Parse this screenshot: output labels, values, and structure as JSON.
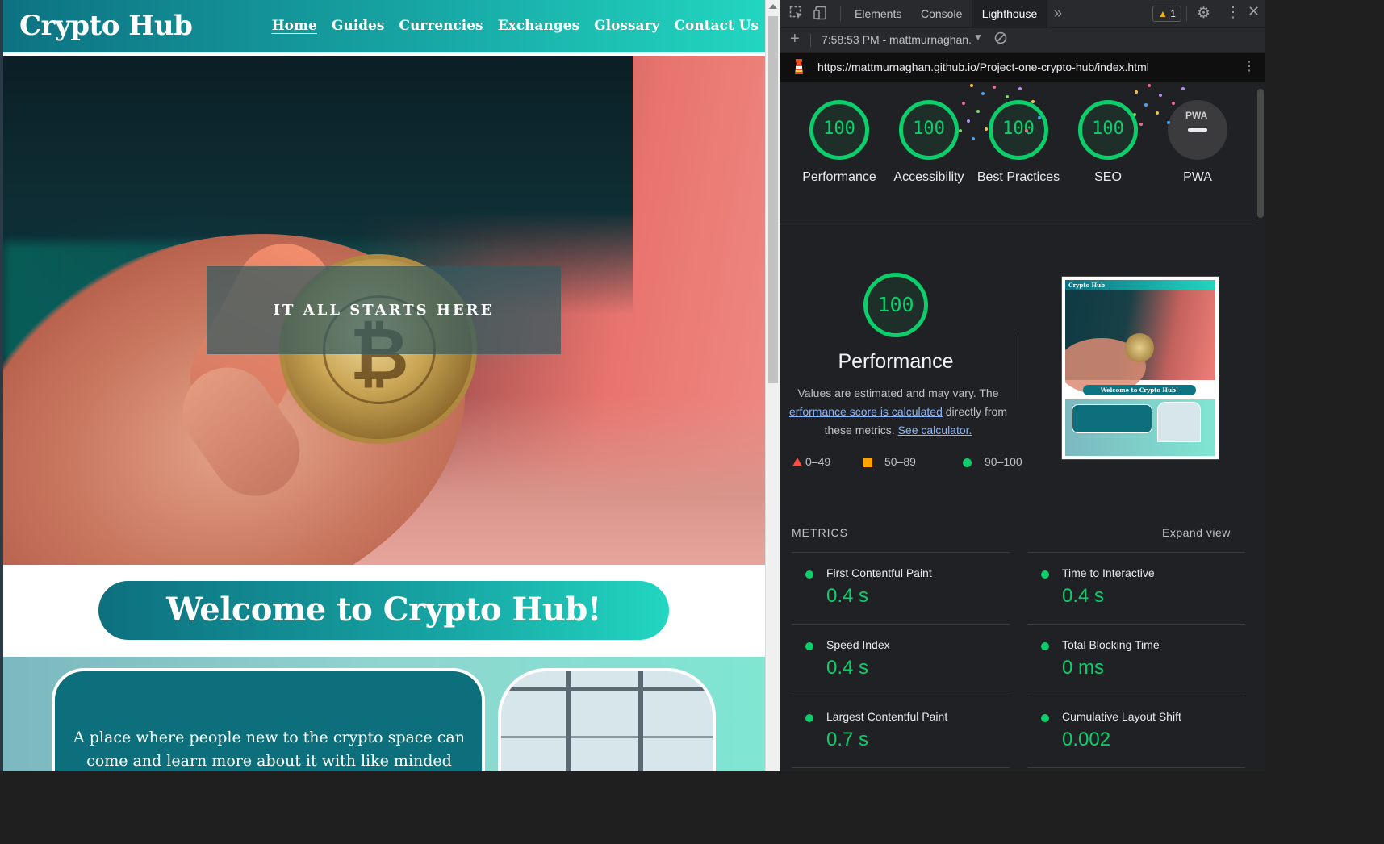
{
  "site": {
    "logo": "Crypto Hub",
    "nav": [
      "Home",
      "Guides",
      "Currencies",
      "Exchanges",
      "Glossary",
      "Contact Us"
    ],
    "active_nav": "Home",
    "tagline": "IT ALL STARTS HERE",
    "welcome": "Welcome to Crypto Hub!",
    "intro_text": "A place where people new to the crypto space can come and learn more about it with like minded individuals.",
    "brand_colors": {
      "teal_dark": "#0d7282",
      "teal_light": "#22d6c0"
    }
  },
  "devtools": {
    "tabs": [
      "Elements",
      "Console",
      "Lighthouse"
    ],
    "active_tab": "Lighthouse",
    "more_tabs_icon": "double-chevron-icon",
    "warning_count": "1",
    "report_time": "7:58:53 PM - mattmurnaghan.",
    "url": "https://mattmurnaghan.github.io/Project-one-crypto-hub/index.html",
    "scores": [
      {
        "label": "Performance",
        "value": "100"
      },
      {
        "label": "Accessibility",
        "value": "100"
      },
      {
        "label": "Best Practices",
        "value": "100"
      },
      {
        "label": "SEO",
        "value": "100"
      }
    ],
    "pwa": {
      "label": "PWA",
      "mini": "PWA"
    },
    "performance": {
      "score": "100",
      "title": "Performance",
      "desc_1": "Values are estimated and may vary. The",
      "desc_link": "erformance score is calculated",
      "desc_2": "directly from these metrics.",
      "calc_link": "See calculator."
    },
    "legend": [
      "0–49",
      "50–89",
      "90–100"
    ],
    "thumbnail": {
      "logo": "Crypto Hub",
      "welcome": "Welcome to Crypto Hub!"
    },
    "metrics_heading": "METRICS",
    "expand_view": "Expand view",
    "metrics": [
      {
        "name": "First Contentful Paint",
        "value": "0.4 s"
      },
      {
        "name": "Time to Interactive",
        "value": "0.4 s"
      },
      {
        "name": "Speed Index",
        "value": "0.4 s"
      },
      {
        "name": "Total Blocking Time",
        "value": "0 ms"
      },
      {
        "name": "Largest Contentful Paint",
        "value": "0.7 s"
      },
      {
        "name": "Cumulative Layout Shift",
        "value": "0.002"
      }
    ],
    "colors": {
      "pass": "#0cce6b",
      "average": "#ffa400",
      "link": "#8ab4f8"
    }
  }
}
